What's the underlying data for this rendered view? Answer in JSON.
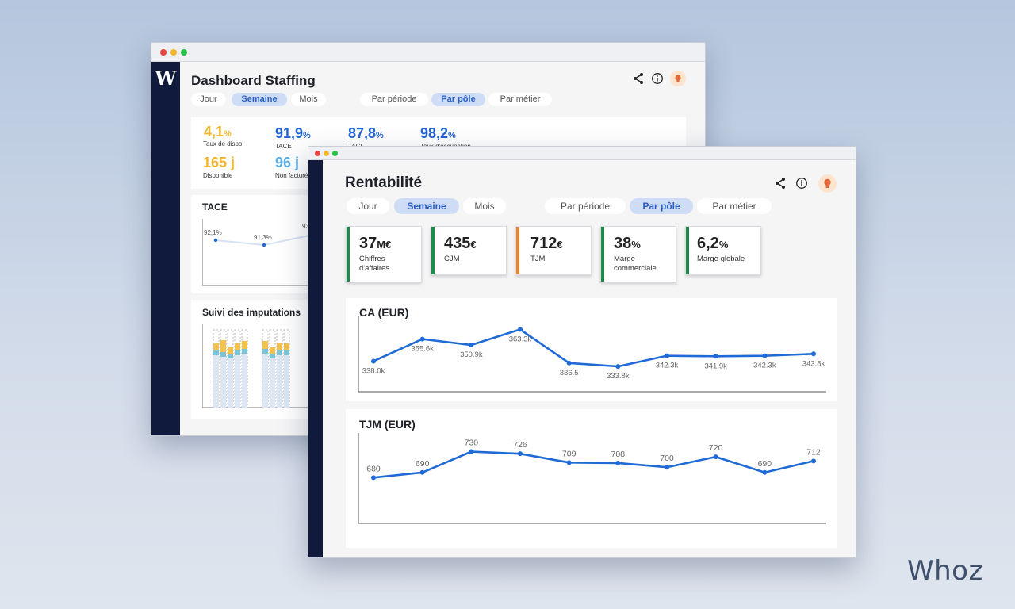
{
  "back_window": {
    "title": "Dashboard Staffing",
    "period_tabs": [
      "Jour",
      "Semaine",
      "Mois"
    ],
    "view_tabs": [
      "Par période",
      "Par pôle",
      "Par métier"
    ],
    "kpis": [
      {
        "value": "4,1",
        "unit": "%",
        "label": "Taux de dispo",
        "color": "#f2b52c"
      },
      {
        "value": "91,9",
        "unit": "%",
        "label": "TACE",
        "color": "#2464d2"
      },
      {
        "value": "87,8",
        "unit": "%",
        "label": "TACI",
        "color": "#2464d2"
      },
      {
        "value": "98,2",
        "unit": "%",
        "label": "Taux d'occupation",
        "color": "#2464d2"
      },
      {
        "value": "165 j",
        "unit": "",
        "label": "Disponible",
        "color": "#f2b52c"
      },
      {
        "value": "96 j",
        "unit": "",
        "label": "Non facturé",
        "color": "#5aaee6"
      }
    ],
    "tace": {
      "title": "TACE",
      "labels": [
        "92,1%",
        "91,3%",
        "93"
      ],
      "values": [
        92.1,
        91.3,
        93.0
      ]
    },
    "imputations": {
      "title": "Suivi des imputations"
    }
  },
  "front_window": {
    "title": "Rentabilité",
    "period_tabs": [
      "Jour",
      "Semaine",
      "Mois"
    ],
    "view_tabs": [
      "Par période",
      "Par pôle",
      "Par métier"
    ],
    "kpis": [
      {
        "value": "37",
        "unit": "M€",
        "label": "Chiffres d'affaires",
        "color": "#1f8a4c"
      },
      {
        "value": "435",
        "unit": "€",
        "label": "CJM",
        "color": "#1f8a4c"
      },
      {
        "value": "712",
        "unit": "€",
        "label": "TJM",
        "color": "#e8842a"
      },
      {
        "value": "38",
        "unit": "%",
        "label": "Marge commerciale",
        "color": "#1f8a4c"
      },
      {
        "value": "6,2",
        "unit": "%",
        "label": "Marge globale",
        "color": "#1f8a4c"
      }
    ]
  },
  "chart_data": [
    {
      "type": "line",
      "title": "CA (EUR)",
      "values": [
        338.0,
        355.6,
        350.9,
        363.3,
        336.5,
        333.8,
        342.3,
        341.9,
        342.3,
        343.8
      ],
      "labels": [
        "338.0k",
        "355.6k",
        "350.9k",
        "363.3k",
        "336.5",
        "333.8k",
        "342.3k",
        "341.9k",
        "342.3k",
        "343.8k"
      ],
      "ylim": [
        325,
        368
      ],
      "color": "#1f6ad6"
    },
    {
      "type": "line",
      "title": "TJM (EUR)",
      "values": [
        680,
        690,
        730,
        726,
        709,
        708,
        700,
        720,
        690,
        712
      ],
      "labels": [
        "680",
        "690",
        "730",
        "726",
        "709",
        "708",
        "700",
        "720",
        "690",
        "712"
      ],
      "ylim": [
        650,
        740
      ],
      "color": "#1f6ad6"
    }
  ],
  "brand": {
    "logo_text": "Whoz"
  }
}
